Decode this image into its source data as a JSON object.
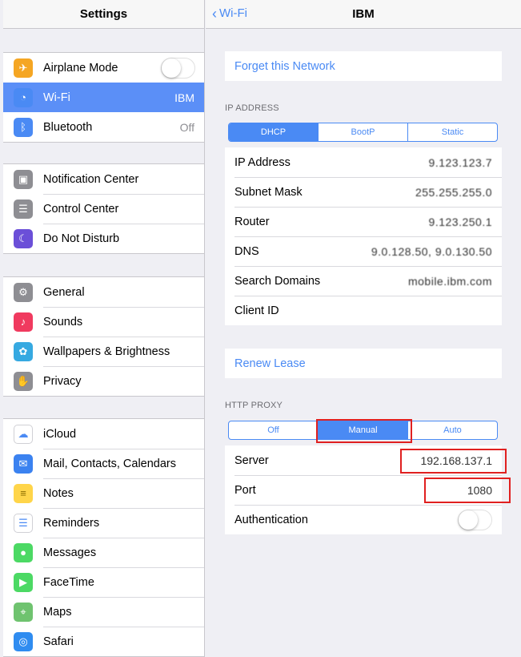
{
  "sidebar": {
    "title": "Settings",
    "groups": [
      [
        {
          "label": "Airplane Mode",
          "icon": "airplane-icon",
          "color": "#f5a623",
          "type": "toggle"
        },
        {
          "label": "Wi-Fi",
          "value": "IBM",
          "icon": "wifi-icon",
          "color": "#4a8af4",
          "selected": true
        },
        {
          "label": "Bluetooth",
          "value": "Off",
          "icon": "bluetooth-icon",
          "color": "#4a8af4"
        }
      ],
      [
        {
          "label": "Notification Center",
          "icon": "notification-center-icon",
          "color": "#8e8e93"
        },
        {
          "label": "Control Center",
          "icon": "control-center-icon",
          "color": "#8e8e93"
        },
        {
          "label": "Do Not Disturb",
          "icon": "moon-icon",
          "color": "#6b4fd8"
        }
      ],
      [
        {
          "label": "General",
          "icon": "gear-icon",
          "color": "#8e8e93"
        },
        {
          "label": "Sounds",
          "icon": "speaker-icon",
          "color": "#f03a5f"
        },
        {
          "label": "Wallpapers & Brightness",
          "icon": "wallpaper-icon",
          "color": "#36a9e1"
        },
        {
          "label": "Privacy",
          "icon": "hand-icon",
          "color": "#8e8e93"
        }
      ],
      [
        {
          "label": "iCloud",
          "icon": "cloud-icon",
          "color": "#ffffff"
        },
        {
          "label": "Mail, Contacts, Calendars",
          "icon": "mail-icon",
          "color": "#3b82f0"
        },
        {
          "label": "Notes",
          "icon": "notes-icon",
          "color": "#ffd54a"
        },
        {
          "label": "Reminders",
          "icon": "reminders-icon",
          "color": "#ffffff"
        },
        {
          "label": "Messages",
          "icon": "messages-icon",
          "color": "#4cd964"
        },
        {
          "label": "FaceTime",
          "icon": "facetime-icon",
          "color": "#4cd964"
        },
        {
          "label": "Maps",
          "icon": "maps-icon",
          "color": "#6fc36f"
        },
        {
          "label": "Safari",
          "icon": "safari-icon",
          "color": "#2f8cf0"
        }
      ]
    ]
  },
  "detail": {
    "back_label": "Wi-Fi",
    "title": "IBM",
    "forget_label": "Forget this Network",
    "ip_section": "IP ADDRESS",
    "ip_tabs": [
      "DHCP",
      "BootP",
      "Static"
    ],
    "ip_selected": 0,
    "ip_rows": [
      {
        "key": "IP Address",
        "value": "9.123.123.7"
      },
      {
        "key": "Subnet Mask",
        "value": "255.255.255.0"
      },
      {
        "key": "Router",
        "value": "9.123.250.1"
      },
      {
        "key": "DNS",
        "value": "9.0.128.50, 9.0.130.50"
      },
      {
        "key": "Search Domains",
        "value": "mobile.ibm.com"
      },
      {
        "key": "Client ID",
        "value": ""
      }
    ],
    "renew_label": "Renew Lease",
    "proxy_section": "HTTP PROXY",
    "proxy_tabs": [
      "Off",
      "Manual",
      "Auto"
    ],
    "proxy_selected": 1,
    "proxy_rows": [
      {
        "key": "Server",
        "value": "192.168.137.1"
      },
      {
        "key": "Port",
        "value": "1080"
      },
      {
        "key": "Authentication",
        "type": "toggle"
      }
    ]
  }
}
